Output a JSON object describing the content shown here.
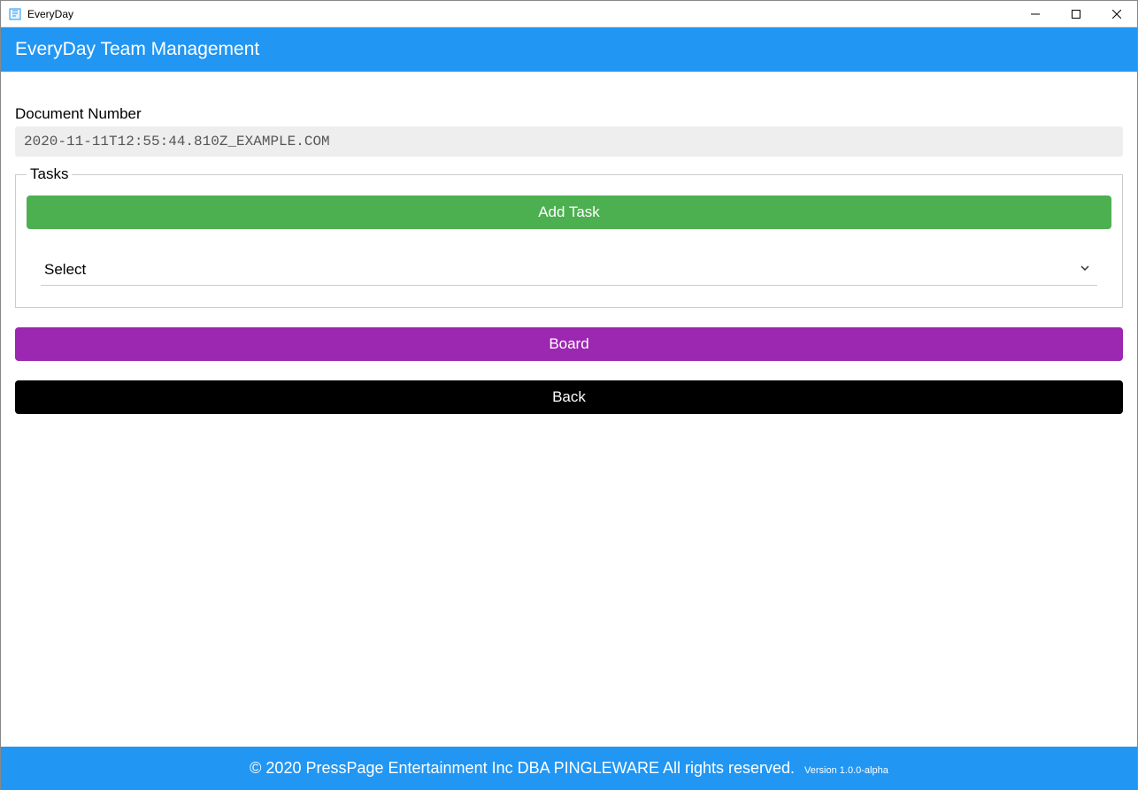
{
  "window": {
    "title": "EveryDay"
  },
  "header": {
    "title": "EveryDay Team Management"
  },
  "form": {
    "document_number_label": "Document Number",
    "document_number_value": "2020-11-11T12:55:44.810Z_EXAMPLE.COM",
    "tasks_legend": "Tasks",
    "add_task_label": "Add Task",
    "select_value": "Select",
    "board_label": "Board",
    "back_label": "Back"
  },
  "footer": {
    "copyright": "© 2020 PressPage Entertainment Inc DBA PINGLEWARE  All rights reserved.",
    "version": "Version 1.0.0-alpha"
  }
}
